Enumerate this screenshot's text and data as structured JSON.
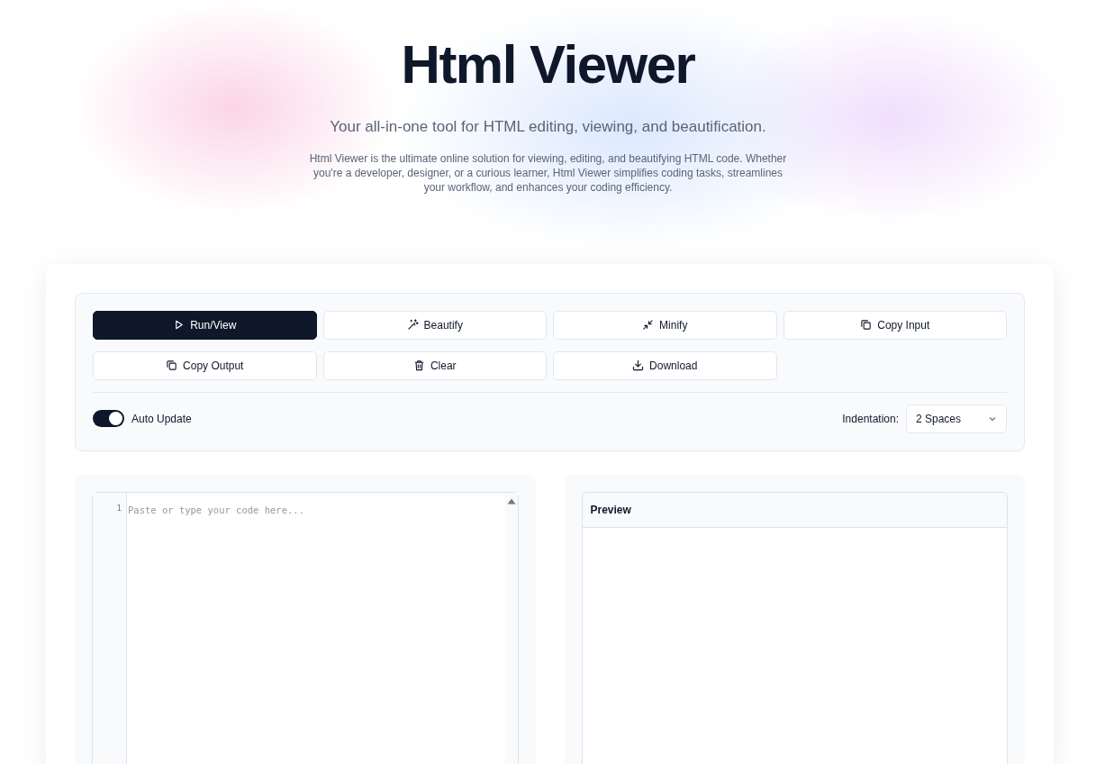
{
  "header": {
    "title": "Html Viewer",
    "subtitle": "Your all-in-one tool for HTML editing, viewing, and beautification.",
    "description": "Html Viewer is the ultimate online solution for viewing, editing, and beautifying HTML code. Whether you're a developer, designer, or a curious learner, Html Viewer simplifies coding tasks, streamlines your workflow, and enhances your coding efficiency."
  },
  "toolbar": {
    "buttons": [
      {
        "label": "Run/View",
        "kind": "play",
        "primary": true
      },
      {
        "label": "Beautify",
        "kind": "wand",
        "primary": false
      },
      {
        "label": "Minify",
        "kind": "minimize",
        "primary": false
      },
      {
        "label": "Copy Input",
        "kind": "copy",
        "primary": false
      },
      {
        "label": "Copy Output",
        "kind": "copy",
        "primary": false
      },
      {
        "label": "Clear",
        "kind": "trash",
        "primary": false
      },
      {
        "label": "Download",
        "kind": "download",
        "primary": false
      }
    ],
    "auto_update": {
      "label": "Auto Update",
      "on": true
    },
    "indentation": {
      "label": "Indentation:",
      "value": "2 Spaces"
    }
  },
  "editor": {
    "line_numbers": [
      "1"
    ],
    "placeholder": "Paste or type your code here..."
  },
  "preview": {
    "title": "Preview"
  }
}
